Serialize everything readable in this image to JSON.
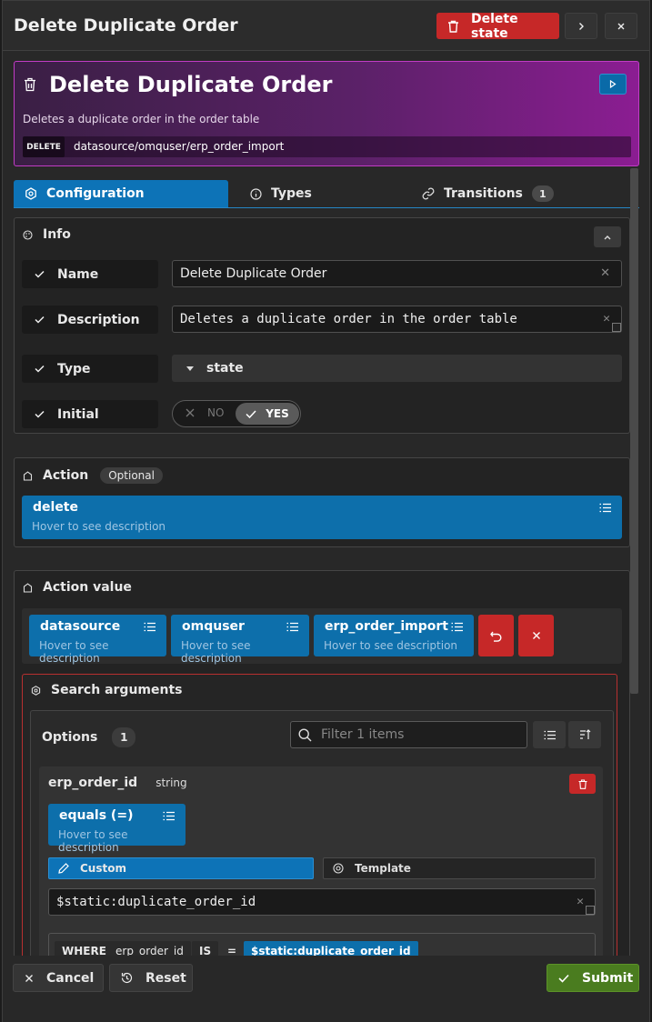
{
  "dialog": {
    "title": "Delete Duplicate Order",
    "delete_label": "Delete state"
  },
  "banner": {
    "title": "Delete Duplicate Order",
    "description": "Deletes a duplicate order in the order table",
    "method": "DELETE",
    "path": "datasource/omquser/erp_order_import"
  },
  "tabs": [
    {
      "label": "Configuration"
    },
    {
      "label": "Types"
    },
    {
      "label": "Transitions",
      "count": "1"
    }
  ],
  "info": {
    "title": "Info",
    "fields": {
      "name_label": "Name",
      "name_value": "Delete Duplicate Order",
      "description_label": "Description",
      "description_value": "Deletes a duplicate order in the order table",
      "type_label": "Type",
      "type_value": "state",
      "initial_label": "Initial",
      "toggle_no": "NO",
      "toggle_yes": "YES"
    }
  },
  "action": {
    "title": "Action",
    "badge": "Optional",
    "chip": {
      "label": "delete",
      "hint": "Hover to see description"
    }
  },
  "action_value": {
    "title": "Action value",
    "chips": [
      {
        "label": "datasource",
        "hint": "Hover to see description"
      },
      {
        "label": "omquser",
        "hint": "Hover to see description"
      },
      {
        "label": "erp_order_import",
        "hint": "Hover to see description"
      }
    ]
  },
  "search": {
    "title": "Search arguments",
    "options_label": "Options",
    "options_count": "1",
    "filter_placeholder": "Filter 1 items",
    "item": {
      "name": "erp_order_id",
      "type": "string",
      "op_label": "equals (=)",
      "op_hint": "Hover to see description",
      "custom_label": "Custom",
      "template_label": "Template",
      "value": "$static:duplicate_order_id",
      "where": {
        "kw": "WHERE",
        "field": "erp_order_id",
        "is": "IS",
        "eq": "=",
        "val": "$static:duplicate_order_id"
      }
    }
  },
  "footer": {
    "cancel": "Cancel",
    "reset": "Reset",
    "submit": "Submit"
  },
  "colors": {
    "accent": "#0d73b7",
    "danger": "#c62828",
    "success": "#4a7c1f",
    "banner": "#8b1d92"
  }
}
